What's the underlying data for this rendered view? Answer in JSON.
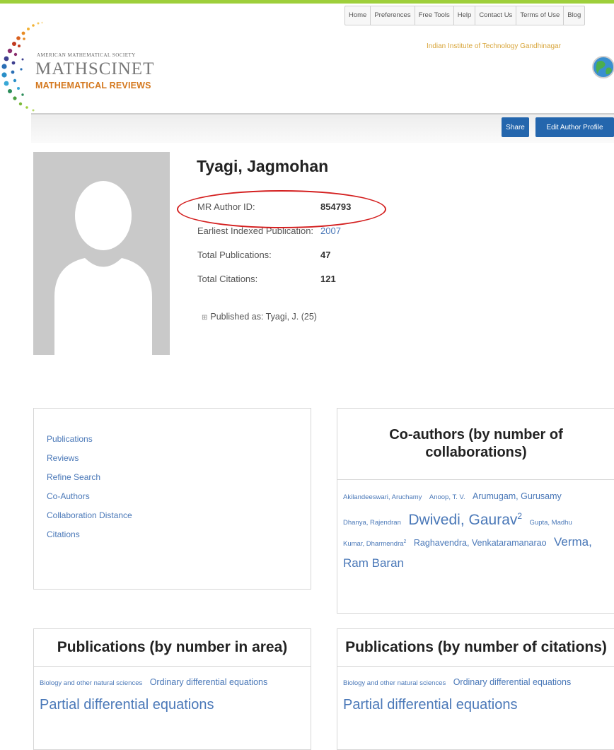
{
  "logo": {
    "ams_text": "AMERICAN MATHEMATICAL SOCIETY",
    "main_text": "MATHSCINET",
    "sub_text": "MATHEMATICAL REVIEWS"
  },
  "topnav": {
    "items": [
      "Home",
      "Preferences",
      "Free Tools",
      "Help",
      "Contact Us",
      "Terms of Use",
      "Blog"
    ]
  },
  "institution": "Indian Institute of Technology Gandhinagar",
  "buttons": {
    "share": "Share",
    "edit_profile": "Edit Author Profile"
  },
  "author": {
    "name": "Tyagi, Jagmohan",
    "fields": [
      {
        "label": "MR Author ID:",
        "value": "854793"
      },
      {
        "label": "Earliest Indexed Publication:",
        "value": "2007"
      },
      {
        "label": "Total Publications:",
        "value": "47"
      },
      {
        "label": "Total Citations:",
        "value": "121"
      }
    ],
    "published_as": "Published as: Tyagi, J. (25)"
  },
  "nav_links": [
    "Publications",
    "Reviews",
    "Refine Search",
    "Co-Authors",
    "Collaboration Distance",
    "Citations"
  ],
  "coauthors": {
    "title": "Co-authors (by number of collaborations)",
    "names": [
      {
        "name": "Akilandeeswari, Aruchamy",
        "sup": ""
      },
      {
        "name": "Anoop, T. V.",
        "sup": ""
      },
      {
        "name": "Arumugam, Gurusamy",
        "sup": ""
      },
      {
        "name": "Dhanya, Rajendran",
        "sup": ""
      },
      {
        "name": "Dwivedi, Gaurav",
        "sup": "2"
      },
      {
        "name": "Gupta, Madhu",
        "sup": ""
      },
      {
        "name": "Kumar, Dharmendra",
        "sup": "2"
      },
      {
        "name": "Raghavendra, Venkataramanarao",
        "sup": ""
      },
      {
        "name": "Verma, Ram Baran",
        "sup": ""
      }
    ]
  },
  "pub_area": {
    "title": "Publications (by number in area)",
    "items": [
      "Biology and other natural sciences",
      "Ordinary differential equations",
      "Partial differential equations"
    ]
  },
  "pub_citations": {
    "title": "Publications (by number of citations)",
    "items": [
      "Biology and other natural sciences",
      "Ordinary differential equations",
      "Partial differential equations"
    ]
  },
  "colors": {
    "accent_green": "#9ecf3b",
    "button_blue": "#2466ad",
    "link_blue": "#4a78b8",
    "logo_orange": "#d4781e",
    "highlight_red": "#d42020"
  }
}
